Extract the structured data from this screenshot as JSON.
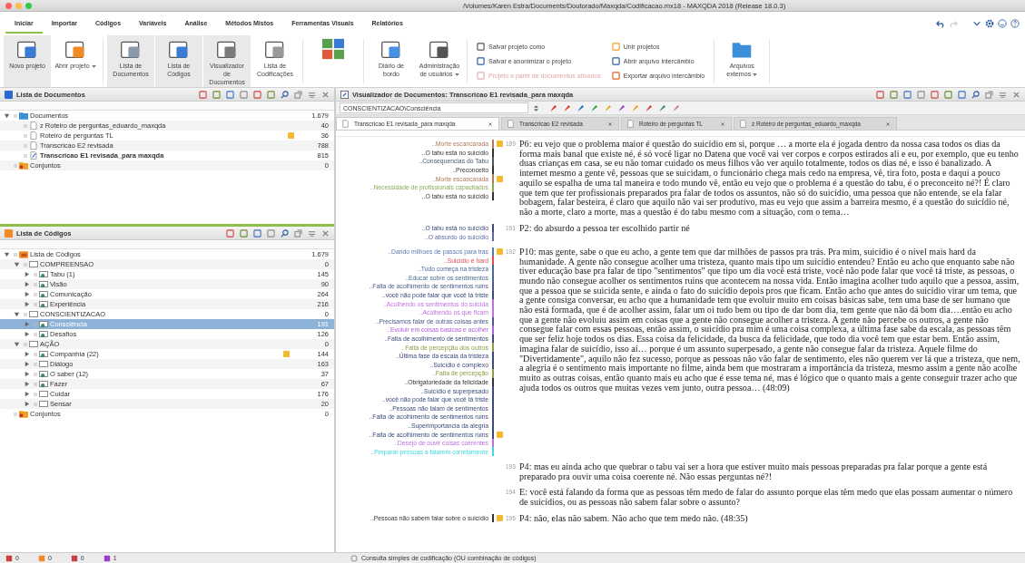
{
  "window": {
    "title": "/Volumes/Karen Estra/Documents/Doutorado/Maxqda/Codificacao.mx18 - MAXQDA 2018  (Release 18.0.3)"
  },
  "ribbon_tabs": [
    {
      "label": "Iniciar",
      "selected": true
    },
    {
      "label": "Importar",
      "selected": false
    },
    {
      "label": "Códigos",
      "selected": false
    },
    {
      "label": "Variáveis",
      "selected": false
    },
    {
      "label": "Análise",
      "selected": false
    },
    {
      "label": "Métodos Mistos",
      "selected": false
    },
    {
      "label": "Ferramentas Visuais",
      "selected": false
    },
    {
      "label": "Relatórios",
      "selected": false
    }
  ],
  "ribbon": {
    "large_buttons": [
      {
        "label": "Novo projeto",
        "on": true,
        "menu": false
      },
      {
        "label": "Abrir projeto",
        "on": false,
        "menu": true
      },
      {
        "label": "Lista de Documentos",
        "on": true,
        "menu": false
      },
      {
        "label": "Lista de Códigos",
        "on": true,
        "menu": false
      },
      {
        "label": "Visualizador de Documentos",
        "on": true,
        "menu": false
      },
      {
        "label": "Lista de Codificações",
        "on": false,
        "menu": false
      },
      {
        "label": "Diário de bordo",
        "on": false,
        "menu": false
      },
      {
        "label": "Administração de usuários",
        "on": false,
        "menu": true
      }
    ],
    "small_buttons": [
      {
        "label": "Salvar projeto como",
        "disabled": false
      },
      {
        "label": "Salvar e anonimizar o projeto",
        "disabled": false
      },
      {
        "label": "Projeto a partir de documentos ativados",
        "disabled": true
      },
      {
        "label": "Unir projetos",
        "disabled": false
      },
      {
        "label": "Abrir arquivo intercâmbio",
        "disabled": false
      },
      {
        "label": "Exportar arquivo intercâmbio",
        "disabled": false
      }
    ],
    "external_button": {
      "label": "Arquivos externos",
      "menu": true
    }
  },
  "document_list": {
    "title": "Lista de Documentos",
    "tree": [
      {
        "label": "Documentos",
        "kind": "folder",
        "count": "1.679",
        "selected": false,
        "expanded": true,
        "children": [
          {
            "label": "z Roteiro de perguntas_eduardo_maxqda",
            "kind": "document",
            "count": "40",
            "selected": false,
            "open": false,
            "memo": false
          },
          {
            "label": "Roteiro de perguntas TL",
            "kind": "document",
            "count": "36",
            "selected": false,
            "open": false,
            "memo": true
          },
          {
            "label": "Transcricao E2 revisada",
            "kind": "document",
            "count": "788",
            "selected": false,
            "open": false,
            "memo": false
          },
          {
            "label": "Transcricao E1 revisada_para maxqda",
            "kind": "document",
            "count": "815",
            "selected": false,
            "open": true,
            "memo": false
          }
        ]
      },
      {
        "label": "Conjuntos",
        "kind": "set",
        "count": "0",
        "selected": false
      }
    ]
  },
  "code_list": {
    "title": "Lista de Códigos",
    "tree": [
      {
        "label": "Lista de Códigos",
        "kind": "root",
        "count": "1.679",
        "selected": false,
        "expanded": true,
        "children": [
          {
            "label": "COMPREENSAO",
            "kind": "group",
            "count": "0",
            "selected": false,
            "expanded": true,
            "children": [
              {
                "label": "Tabu (1)",
                "kind": "code",
                "count": "145",
                "selected": false,
                "expanded": false
              },
              {
                "label": "Visão",
                "kind": "code",
                "count": "90",
                "selected": false,
                "expanded": false
              },
              {
                "label": "Comunicação",
                "kind": "code",
                "count": "264",
                "selected": false,
                "expanded": false
              },
              {
                "label": "Experiência",
                "kind": "code",
                "count": "216",
                "selected": false,
                "expanded": false
              }
            ]
          },
          {
            "label": "CONSCIENTIZACAO",
            "kind": "group",
            "count": "0",
            "selected": false,
            "expanded": true,
            "children": [
              {
                "label": "Consciência",
                "kind": "code",
                "count": "191",
                "selected": true,
                "expanded": false
              },
              {
                "label": "Desafios",
                "kind": "code",
                "count": "126",
                "selected": false,
                "expanded": false
              }
            ]
          },
          {
            "label": "AÇÃO",
            "kind": "group",
            "count": "0",
            "selected": false,
            "expanded": true,
            "children": [
              {
                "label": "Companhia (22)",
                "kind": "code",
                "count": "144",
                "selected": false,
                "expanded": false,
                "memo": true
              },
              {
                "label": "Diálogo",
                "kind": "group",
                "count": "163",
                "selected": false,
                "expanded": false
              },
              {
                "label": "O saber (12)",
                "kind": "code",
                "count": "37",
                "selected": false,
                "expanded": false
              },
              {
                "label": "Fazer",
                "kind": "code",
                "count": "67",
                "selected": false,
                "expanded": false
              },
              {
                "label": "Cuidar",
                "kind": "group",
                "count": "176",
                "selected": false,
                "expanded": false
              },
              {
                "label": "Sensar",
                "kind": "group",
                "count": "20",
                "selected": false,
                "expanded": false
              }
            ]
          }
        ]
      },
      {
        "label": "Conjuntos",
        "kind": "set",
        "count": "0",
        "selected": false
      }
    ]
  },
  "document_viewer": {
    "title": "Visualizador de Documentos: Transcricao E1 revisada_para maxqda",
    "code_field": {
      "value": "CONSCIENTIZACAO\\Consciência"
    },
    "tabs": [
      {
        "label": "Transcricao E1 revisada_para maxqda",
        "selected": true
      },
      {
        "label": "Transcricao E2 revisada",
        "selected": false
      },
      {
        "label": "Roteiro de perguntas TL",
        "selected": false
      },
      {
        "label": "z Roteiro de perguntas_eduardo_maxqda",
        "selected": false
      }
    ],
    "paragraphs": [
      {
        "number": "189",
        "text": "P6: eu vejo que o problema maior é questão do suicídio em si, porque … a morte ela é jogada dentro da nossa casa todos os dias da forma mais banal que existe né, é só você ligar no Datena que você vai ver corpos e corpos estirados ali e eu, por exemplo, que eu tenho duas crianças em casa, se eu não tomar cuidado os meus filhos vão ver aquilo totalmente, todos os dias né, e isso é banalizado. A internet mesmo a gente vê, pessoas que se suicidam, o funcionário chega mais cedo na empresa, vê, tira foto, posta e daqui a pouco aquilo se espalha de uma tal maneira e todo mundo vê, então eu vejo que o problema é a questão do tabu, é o preconceito né?! É claro que tem que ter profissionais preparados pra falar de todos os assuntos, não só do suicídio, uma pessoa que não entende, se ela falar bobagem, falar besteira, é claro que aquilo não vai ser produtivo, mas eu vejo que assim a barreira mesmo, é a questão do suicídio né, não a morte, claro a morte, mas a questão é do tabu mesmo com a situação, com o tema…",
        "codes": [
          {
            "label": "..Morte escancarada",
            "color": "#b07a5a",
            "memo": true
          },
          {
            "label": "..O tabu está no suicídio",
            "color": "#333333",
            "memo": false
          },
          {
            "label": "..Consequencias do Tabu",
            "color": "#4a5a6a",
            "memo": false
          },
          {
            "label": "..Preconceito",
            "color": "#333333",
            "memo": false
          },
          {
            "label": "..Morte escancarada",
            "color": "#b07a5a",
            "memo": true
          },
          {
            "label": "..Necessidade de profissionais capacitados",
            "color": "#8aac5a",
            "memo": false
          },
          {
            "label": "..O tabu está no suicídio",
            "color": "#333333",
            "memo": false
          }
        ]
      },
      {
        "number": "191",
        "text": "P2: do absurdo a pessoa ter escolhido partir né",
        "codes": [
          {
            "label": "..O tabu está no suicídio",
            "color": "#3a4a7a",
            "memo": false
          },
          {
            "label": "..O absurdo do suicídio",
            "color": "#5a6aa0",
            "memo": false
          }
        ]
      },
      {
        "number": "192",
        "text": "P10: mas gente, sabe o que eu acho, a gente tem que dar milhões de passos pra trás. Pra mim, suicídio é o nível mais hard da humanidade. A gente não consegue acolher uma tristeza, quanto mais tipo um suicídio entendeu? Então eu acho que enquanto sabe não tiver educação base pra falar de tipo \"sentimentos\" que tipo um dia você está triste, você não pode falar que você tá triste, as pessoas, o mundo não consegue acolher os sentimentos ruins que acontecem na nossa vida. Então imagina acolher tudo aquilo que a pessoa, assim, que a pessoa que se suicida sente, e ainda o fato do suicídio depois pros que ficam. Então acho que antes do suicídio virar um tema, que a gente consiga conversar, eu acho que a humanidade tem que evoluir muito em coisas básicas sabe, tem uma base de ser humano que não está formada, que é de acolher assim, falar um oi tudo bem ou tipo de dar bom dia, tem gente que não dá bom dia….então eu acho que a gente não evoluiu assim em coisas que a gente não consegue acolher a tristeza. A gente não percebe os outros, a gente não consegue falar com essas pessoas, então assim, o suicídio pra mim é uma coisa complexa, a última fase sabe da escala, as pessoas têm que ser feliz hoje todos os dias. Essa coisa da felicidade, da busca da felicidade, que todo dia você tem que estar bem. Então assim, imagina falar de suicídio, isso aí… porque é um assunto superpesado, a gente não consegue falar da tristeza. Aquele filme do \"Divertidamente\", aquilo não fez sucesso, porque as pessoas não vão falar de sentimento, eles não querem ver lá que a tristeza, que nem, a alegria é o sentimento mais importante no filme, ainda bem que mostraram a importância da tristeza, mesmo assim a gente não acolhe muito as outras coisas, então quanto mais eu acho que é esse tema né, mas é lógico que o quanto mais a gente conseguir trazer acho que ajuda todos os outros que muitas vezes vem junto, outra pessoa… (48:09)",
        "codes": [
          {
            "label": "..Dando milhoes de passos para tras",
            "color": "#5a7ab0",
            "memo": true
          },
          {
            "label": "..Suicídio é hard",
            "color": "#e05050",
            "memo": false
          },
          {
            "label": "..Tudo começa na tristeza",
            "color": "#4a6a9a",
            "memo": false
          },
          {
            "label": "..Educar sobre os sentimentos",
            "color": "#4a6a8a",
            "memo": false
          },
          {
            "label": "..Falta de acolhimento de sentimentos ruins",
            "color": "#4a5a8a",
            "memo": false
          },
          {
            "label": "..você não pode falar que você tá triste",
            "color": "#3a4a7a",
            "memo": false
          },
          {
            "label": "..Acolhendo os sentimentos do suicida",
            "color": "#c070e0",
            "memo": false
          },
          {
            "label": "..Acolhendo os que ficam",
            "color": "#c070e0",
            "memo": false
          },
          {
            "label": "..Precisamos falar de outras coisas antes",
            "color": "#4a5a8a",
            "memo": false
          },
          {
            "label": "..Evoluir em coisas basicas e acolher",
            "color": "#b060e0",
            "memo": false
          },
          {
            "label": "..Falta de acolhimento de sentimentos",
            "color": "#3a4a7a",
            "memo": false
          },
          {
            "label": "..Falta de percepção dos outros",
            "color": "#8aa040",
            "memo": false
          },
          {
            "label": "..Última fase da escala da tristeza",
            "color": "#3a4a7a",
            "memo": false
          },
          {
            "label": "..Suicídio é complexo",
            "color": "#3a4a7a",
            "memo": false
          },
          {
            "label": "..Falta de percepção",
            "color": "#8aa040",
            "memo": false
          },
          {
            "label": "..Obrigatoriedade da felicidade",
            "color": "#333333",
            "memo": false
          },
          {
            "label": "..Suicídio é superpesado",
            "color": "#3a4a7a",
            "memo": false
          },
          {
            "label": "..você não pode falar que você tá triste",
            "color": "#3a4a7a",
            "memo": false
          },
          {
            "label": "..Pessoas não falam de sentimentos",
            "color": "#3a4a7a",
            "memo": false
          },
          {
            "label": "..Falta de acolhimento de sentimentos ruins",
            "color": "#3a4a7a",
            "memo": false
          },
          {
            "label": "..Superimportancia da alegria",
            "color": "#3a4a7a",
            "memo": false
          },
          {
            "label": "..Falta de acolhimento de sentimentos ruins",
            "color": "#3a4a7a",
            "memo": true
          },
          {
            "label": "..Desejo de ouvir coisas coerentes",
            "color": "#c070e0",
            "memo": false
          },
          {
            "label": "..Preparar pessoas a falarem corretamente",
            "color": "#40d8e0",
            "memo": false
          }
        ]
      },
      {
        "number": "193",
        "text": "P4: mas eu ainda acho que quebrar o tabu vai ser a hora que estiver muito mais pessoas preparadas pra falar porque a gente está preparado pra ouvir uma coisa coerente né. Não essas perguntas né?!"
      },
      {
        "number": "194",
        "text": "E: você está falando da forma que as pessoas têm medo de falar do assunto porque elas têm medo que elas possam aumentar o número de suicídios, ou as pessoas não sabem falar sobre o assunto?"
      },
      {
        "number": "195",
        "text": "P4: não, elas não sabem. Não acho que tem medo não. (48:35)",
        "codes": [
          {
            "label": "..Pessoas não sabem falar sobre o suicídio",
            "color": "#333333",
            "memo": true
          }
        ]
      }
    ]
  },
  "status_bar": {
    "counters": [
      {
        "count": "0"
      },
      {
        "count": "0"
      },
      {
        "count": "0"
      },
      {
        "count": "1"
      }
    ],
    "query": "Consulta simples de codificação (OU combinação de códigos)"
  }
}
